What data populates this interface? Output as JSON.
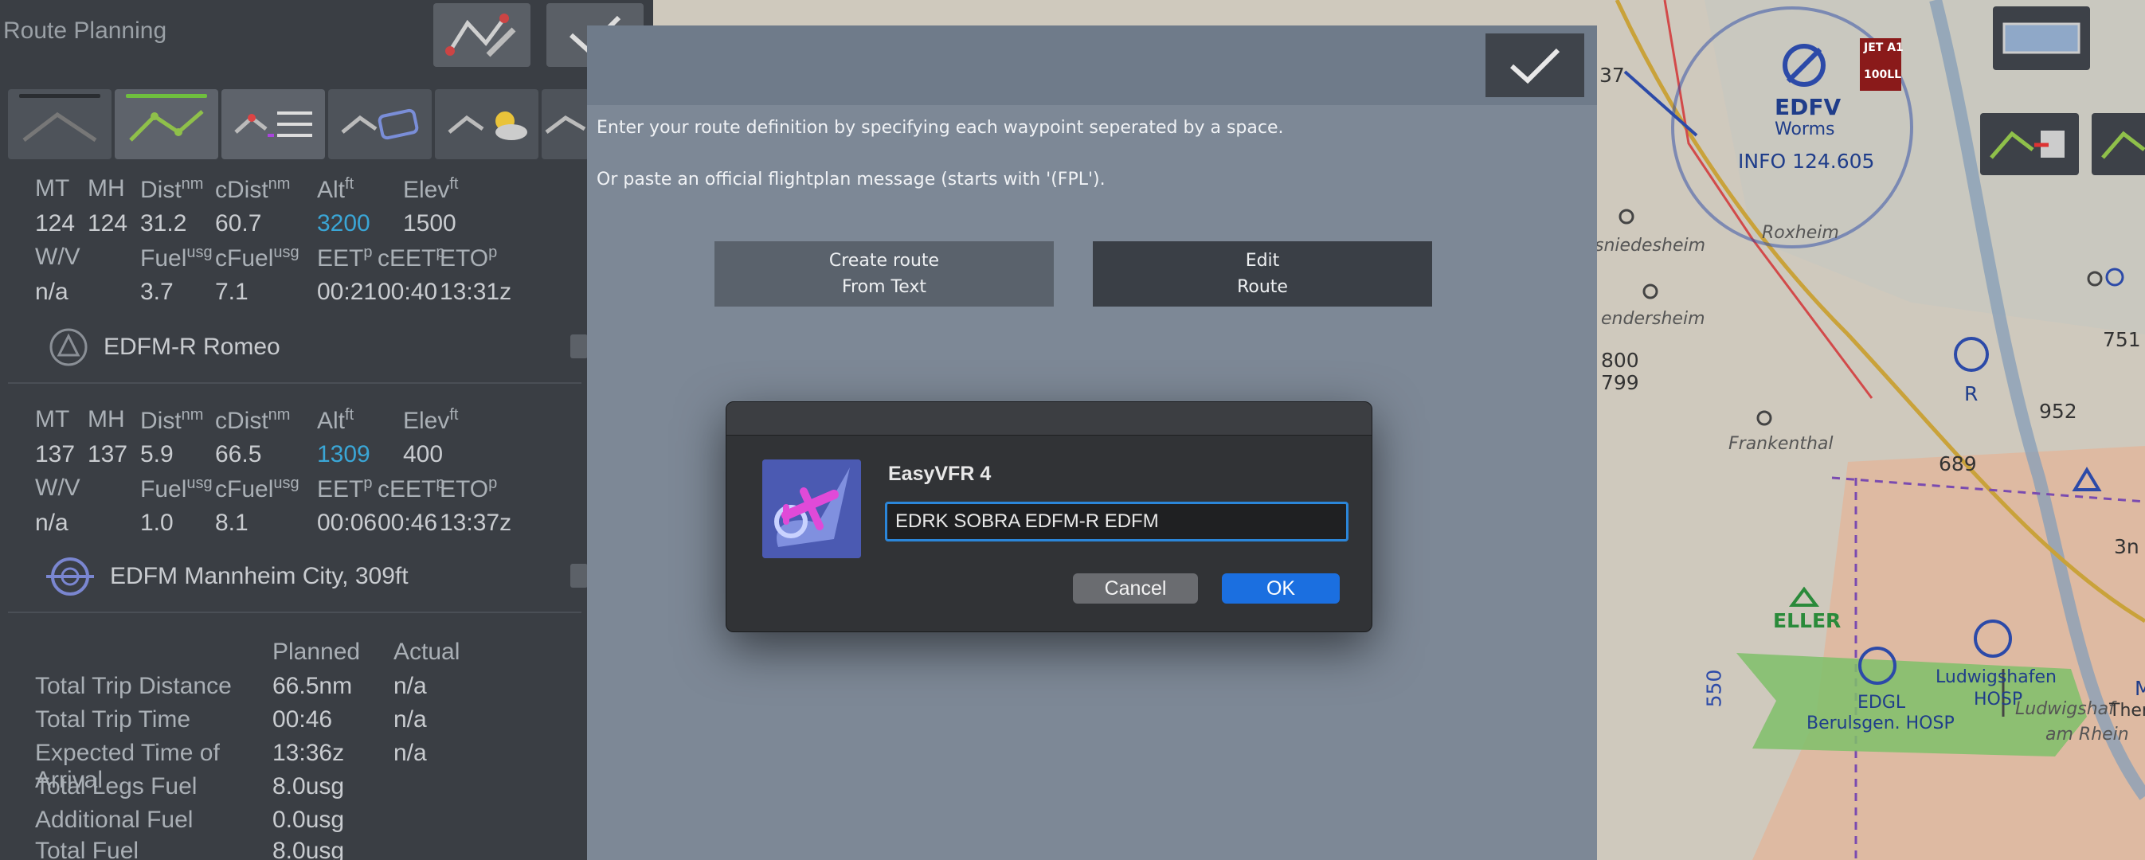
{
  "panel": {
    "title": "Route Planning"
  },
  "legs": [
    {
      "headers": {
        "mt": "MT",
        "mh": "MH",
        "dist": "Dist",
        "dist_unit": "nm",
        "cdist": "cDist",
        "cdist_unit": "nm",
        "alt": "Alt",
        "alt_unit": "ft",
        "elev": "Elev",
        "elev_unit": "ft"
      },
      "values": {
        "mt": "124",
        "mh": "124",
        "dist": "31.2",
        "cdist": "60.7",
        "alt": "3200",
        "elev": "1500"
      },
      "headers2": {
        "wv": "W/V",
        "fuel": "Fuel",
        "fuel_unit": "usg",
        "cfuel": "cFuel",
        "cfuel_unit": "usg",
        "eet": "EET",
        "eet_unit": "p",
        "ceet": "cEET",
        "ceet_unit": "p",
        "eto": "ETO",
        "eto_unit": "p"
      },
      "values2": {
        "wv": "n/a",
        "fuel": "3.7",
        "cfuel": "7.1",
        "eet": "00:21",
        "ceet": "00:40",
        "eto": "13:31z"
      },
      "waypoint": "EDFM-R Romeo"
    },
    {
      "headers": {
        "mt": "MT",
        "mh": "MH",
        "dist": "Dist",
        "dist_unit": "nm",
        "cdist": "cDist",
        "cdist_unit": "nm",
        "alt": "Alt",
        "alt_unit": "ft",
        "elev": "Elev",
        "elev_unit": "ft"
      },
      "values": {
        "mt": "137",
        "mh": "137",
        "dist": "5.9",
        "cdist": "66.5",
        "alt": "1309",
        "elev": "400"
      },
      "headers2": {
        "wv": "W/V",
        "fuel": "Fuel",
        "fuel_unit": "usg",
        "cfuel": "cFuel",
        "cfuel_unit": "usg",
        "eet": "EET",
        "eet_unit": "p",
        "ceet": "cEET",
        "ceet_unit": "p",
        "eto": "ETO",
        "eto_unit": "p"
      },
      "values2": {
        "wv": "n/a",
        "fuel": "1.0",
        "cfuel": "8.1",
        "eet": "00:06",
        "ceet": "00:46",
        "eto": "13:37z"
      },
      "waypoint": "EDFM Mannheim City, 309ft"
    }
  ],
  "summary": {
    "col_planned": "Planned",
    "col_actual": "Actual",
    "rows": [
      {
        "label": "Total Trip Distance",
        "planned": "66.5nm",
        "actual": "n/a"
      },
      {
        "label": "Total Trip Time",
        "planned": "00:46",
        "actual": "n/a"
      },
      {
        "label": "Expected Time of Arrival",
        "planned": "13:36z",
        "actual": "n/a"
      },
      {
        "label": "Total Legs Fuel",
        "planned": "8.0usg",
        "actual": ""
      },
      {
        "label": "Additional Fuel",
        "planned": "0.0usg",
        "actual": ""
      },
      {
        "label": "Total Fuel",
        "planned": "8.0usg",
        "actual": ""
      }
    ]
  },
  "route_panel": {
    "instruction1": "Enter your route definition by specifying each waypoint seperated by a space.",
    "instruction2": "Or paste an official flightplan message (starts with '(FPL').",
    "create_button": [
      "Create route",
      "From Text"
    ],
    "edit_button": [
      "Edit",
      "Route"
    ]
  },
  "dialog": {
    "app_name": "EasyVFR 4",
    "input_value": "EDRK SOBRA EDFM-R EDFM",
    "cancel_label": "Cancel",
    "ok_label": "OK"
  },
  "map": {
    "labels": {
      "edfv": "EDFV",
      "worms": "Worms",
      "info": "INFO 124.605",
      "roxheim": "Roxheim",
      "sniedesheim": "sniedesheim",
      "bendersheim": "endersheim",
      "frankenthal": "Frankenthal",
      "eller": "ELLER",
      "edgl": "EDGL",
      "berulsgen": "Berulsgen. HOSP",
      "ludwigshafen": "Ludwigshafen",
      "hosp": "HOSP",
      "ludwigshafen2": "Ludwigshaf",
      "amrhein": "am Rhein",
      "jet": "JET A1",
      "ll": "100LL",
      "n37": "37",
      "n751": "751",
      "n952": "952",
      "n689": "689",
      "n800": "800",
      "n799": "799",
      "n3n": "3n",
      "n550": "550",
      "r": "R",
      "m": "M",
      "the": "Ther"
    }
  },
  "colors": {
    "accent_blue": "#1b6fe0",
    "alt_blue": "#3aa6d6",
    "tab_green": "#6fbf3e"
  }
}
